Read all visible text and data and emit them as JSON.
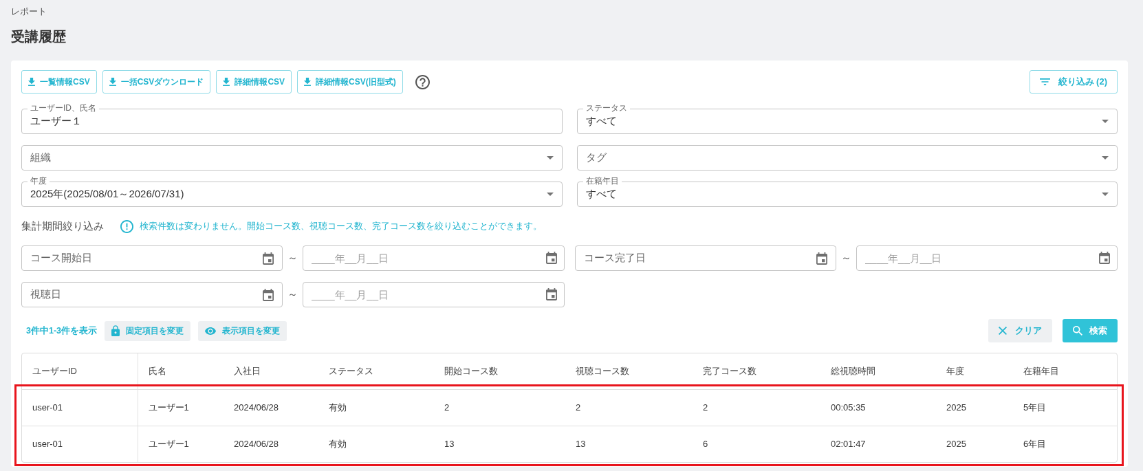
{
  "breadcrumb": "レポート",
  "page_title": "受講履歴",
  "export_buttons": [
    {
      "label": "一覧情報CSV"
    },
    {
      "label": "一括CSVダウンロード"
    },
    {
      "label": "詳細情報CSV"
    },
    {
      "label": "詳細情報CSV(旧型式)"
    }
  ],
  "filter_button": {
    "label": "絞り込み (2)"
  },
  "filters": [
    {
      "kind": "text",
      "label": "ユーザーID、氏名",
      "value": "ユーザー１"
    },
    {
      "kind": "select",
      "label": "ステータス",
      "value": "すべて"
    },
    {
      "kind": "select",
      "label": "組織"
    },
    {
      "kind": "select",
      "label": "タグ"
    },
    {
      "kind": "select",
      "label": "年度",
      "value": "2025年(2025/08/01～2026/07/31)"
    },
    {
      "kind": "select",
      "label": "在籍年目",
      "value": "すべて"
    }
  ],
  "period": {
    "label": "集計期間絞り込み",
    "note": "検索件数は変わりません。開始コース数、視聴コース数、完了コース数を絞り込むことができます。",
    "ranges": [
      {
        "from": {
          "label": "コース開始日"
        },
        "separator": "～",
        "to": {
          "placeholder": "____年__月__日"
        }
      },
      {
        "from": {
          "label": "コース完了日"
        },
        "separator": "～",
        "to": {
          "placeholder": "____年__月__日"
        }
      },
      {
        "from": {
          "label": "視聴日"
        },
        "separator": "～",
        "to": {
          "placeholder": "____年__月__日"
        }
      }
    ]
  },
  "results": {
    "summary": "3件中1-3件を表示",
    "column_buttons": [
      {
        "kind": "lock",
        "label": "固定項目を変更"
      },
      {
        "kind": "eye",
        "label": "表示項目を変更"
      }
    ],
    "clear_button": {
      "label": "クリア"
    },
    "search_button": {
      "label": "検索"
    }
  },
  "table": {
    "columns": [
      "ユーザーID",
      "氏名",
      "入社日",
      "ステータス",
      "開始コース数",
      "視聴コース数",
      "完了コース数",
      "総視聴時間",
      "年度",
      "在籍年目"
    ],
    "rows": [
      [
        "user-01",
        "ユーザー1",
        "2024/06/28",
        "有効",
        "2",
        "2",
        "2",
        "00:05:35",
        "2025",
        "5年目"
      ],
      [
        "user-01",
        "ユーザー1",
        "2024/06/28",
        "有効",
        "13",
        "13",
        "6",
        "02:01:47",
        "2025",
        "6年目"
      ]
    ],
    "highlighted": true
  }
}
